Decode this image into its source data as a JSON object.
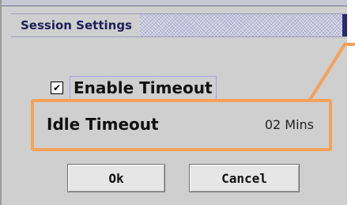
{
  "dialog": {
    "title": "Session Settings"
  },
  "enable_timeout": {
    "label": "Enable Timeout",
    "checked": true,
    "check_glyph": "✔"
  },
  "idle_timeout": {
    "label": "Idle Timeout",
    "value": "02 Mins"
  },
  "buttons": {
    "ok_label": "Ok",
    "cancel_label": "Cancel"
  },
  "colors": {
    "highlight": "#f4a15a",
    "title_text": "#1e1e5a",
    "panel_bg": "#cfcfcf"
  }
}
